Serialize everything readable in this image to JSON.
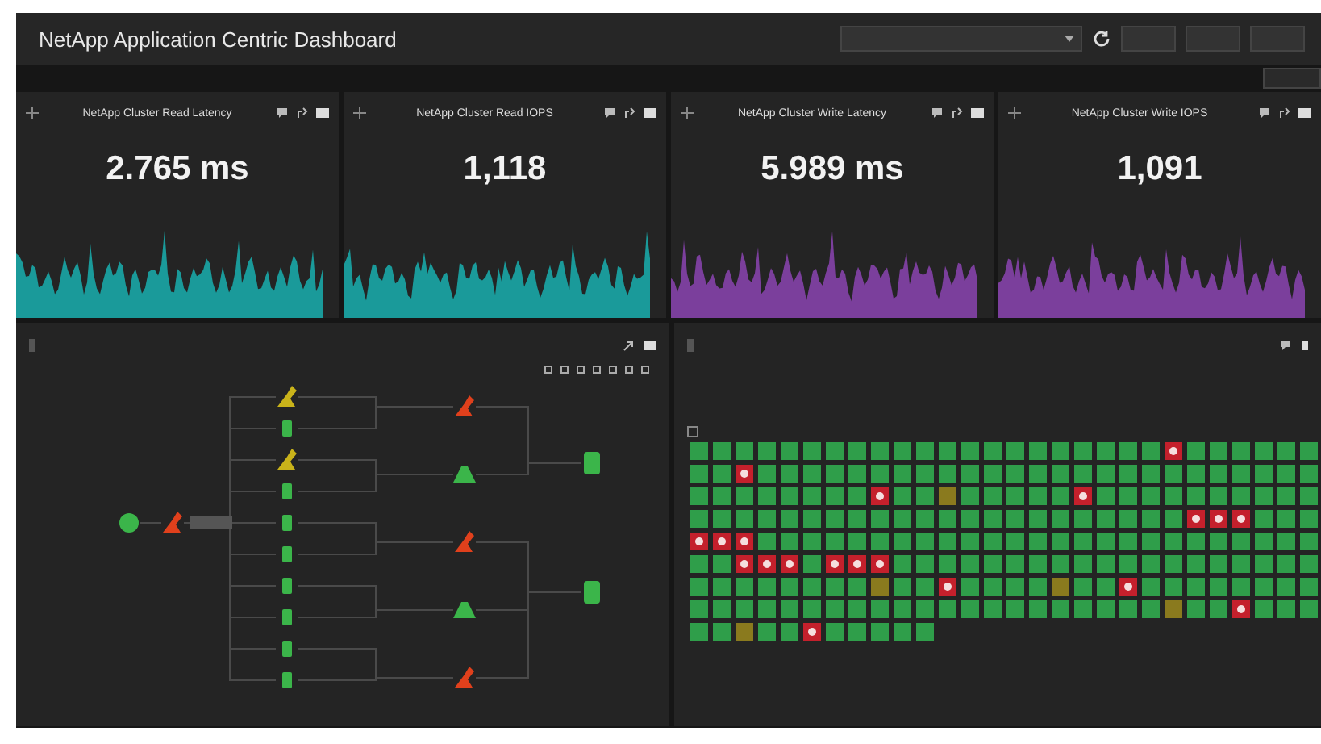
{
  "header": {
    "title": "NetApp Application Centric Dashboard"
  },
  "stat_panels": [
    {
      "title": "NetApp Cluster Read Latency",
      "value": "2.765 ms",
      "color": "#1a9a9a"
    },
    {
      "title": "NetApp Cluster Read IOPS",
      "value": "1,118",
      "color": "#1a9a9a"
    },
    {
      "title": "NetApp Cluster Write Latency",
      "value": "5.989 ms",
      "color": "#7b3f9c"
    },
    {
      "title": "NetApp Cluster Write IOPS",
      "value": "1,091",
      "color": "#7b3f9c"
    }
  ],
  "topology": {
    "columns": [
      [
        {
          "kind": "endpoint",
          "color": "#3bb54a"
        }
      ],
      [
        {
          "kind": "service",
          "color": "#e0401c"
        }
      ],
      [
        {
          "kind": "service",
          "color": "#c9b31a"
        },
        {
          "kind": "vm",
          "color": "#3bb54a"
        },
        {
          "kind": "service",
          "color": "#c9b31a"
        },
        {
          "kind": "vm",
          "color": "#3bb54a"
        },
        {
          "kind": "vm",
          "color": "#3bb54a"
        },
        {
          "kind": "vm",
          "color": "#3bb54a"
        },
        {
          "kind": "vm",
          "color": "#3bb54a"
        },
        {
          "kind": "vm",
          "color": "#3bb54a"
        },
        {
          "kind": "vm",
          "color": "#3bb54a"
        },
        {
          "kind": "vm",
          "color": "#3bb54a"
        }
      ],
      [
        {
          "kind": "service",
          "color": "#e0401c"
        },
        {
          "kind": "host",
          "color": "#3bb54a"
        },
        {
          "kind": "service",
          "color": "#e0401c"
        },
        {
          "kind": "host",
          "color": "#3bb54a"
        },
        {
          "kind": "service",
          "color": "#e0401c"
        }
      ],
      [
        {
          "kind": "storage",
          "color": "#3bb54a"
        },
        {
          "kind": "storage",
          "color": "#3bb54a"
        }
      ]
    ]
  },
  "heatmap": {
    "legend": {
      "checked": false
    },
    "rows": [
      [
        {
          "color": "#2f9e4a"
        },
        {
          "color": "#2f9e4a"
        },
        {
          "color": "#2f9e4a"
        },
        {
          "color": "#2f9e4a"
        },
        {
          "color": "#2f9e4a"
        },
        {
          "color": "#2f9e4a"
        },
        {
          "color": "#2f9e4a"
        },
        {
          "color": "#2f9e4a"
        },
        {
          "color": "#2f9e4a"
        },
        {
          "color": "#2f9e4a"
        },
        {
          "color": "#2f9e4a"
        },
        {
          "color": "#2f9e4a"
        },
        {
          "color": "#2f9e4a"
        },
        {
          "color": "#2f9e4a"
        },
        {
          "color": "#2f9e4a"
        },
        {
          "color": "#2f9e4a"
        },
        {
          "color": "#2f9e4a"
        },
        {
          "color": "#2f9e4a"
        },
        {
          "color": "#2f9e4a"
        },
        {
          "color": "#2f9e4a"
        },
        {
          "color": "#2f9e4a"
        },
        {
          "color": "#c4202c"
        },
        {
          "color": "#2f9e4a"
        },
        {
          "color": "#2f9e4a"
        },
        {
          "color": "#2f9e4a"
        },
        {
          "color": "#2f9e4a"
        },
        {
          "color": "#2f9e4a"
        },
        {
          "color": "#2f9e4a"
        }
      ],
      [
        {
          "color": "#2f9e4a"
        },
        {
          "color": "#2f9e4a"
        },
        {
          "color": "#c4202c"
        },
        {
          "color": "#2f9e4a"
        },
        {
          "color": "#2f9e4a"
        },
        {
          "color": "#2f9e4a"
        },
        {
          "color": "#2f9e4a"
        },
        {
          "color": "#2f9e4a"
        },
        {
          "color": "#2f9e4a"
        },
        {
          "color": "#2f9e4a"
        },
        {
          "color": "#2f9e4a"
        },
        {
          "color": "#2f9e4a"
        },
        {
          "color": "#2f9e4a"
        },
        {
          "color": "#2f9e4a"
        },
        {
          "color": "#2f9e4a"
        },
        {
          "color": "#2f9e4a"
        },
        {
          "color": "#2f9e4a"
        },
        {
          "color": "#2f9e4a"
        },
        {
          "color": "#2f9e4a"
        },
        {
          "color": "#2f9e4a"
        },
        {
          "color": "#2f9e4a"
        },
        {
          "color": "#2f9e4a"
        },
        {
          "color": "#2f9e4a"
        },
        {
          "color": "#2f9e4a"
        },
        {
          "color": "#2f9e4a"
        },
        {
          "color": "#2f9e4a"
        },
        {
          "color": "#2f9e4a"
        },
        {
          "color": "#2f9e4a"
        }
      ],
      [
        {
          "color": "#2f9e4a"
        },
        {
          "color": "#2f9e4a"
        },
        {
          "color": "#2f9e4a"
        },
        {
          "color": "#2f9e4a"
        },
        {
          "color": "#2f9e4a"
        },
        {
          "color": "#2f9e4a"
        },
        {
          "color": "#2f9e4a"
        },
        {
          "color": "#2f9e4a"
        },
        {
          "color": "#c4202c"
        },
        {
          "color": "#2f9e4a"
        },
        {
          "color": "#2f9e4a"
        },
        {
          "color": "#8a7a1e"
        },
        {
          "color": "#2f9e4a"
        },
        {
          "color": "#2f9e4a"
        },
        {
          "color": "#2f9e4a"
        },
        {
          "color": "#2f9e4a"
        },
        {
          "color": "#2f9e4a"
        },
        {
          "color": "#c4202c"
        },
        {
          "color": "#2f9e4a"
        },
        {
          "color": "#2f9e4a"
        },
        {
          "color": "#2f9e4a"
        },
        {
          "color": "#2f9e4a"
        },
        {
          "color": "#2f9e4a"
        },
        {
          "color": "#2f9e4a"
        },
        {
          "color": "#2f9e4a"
        },
        {
          "color": "#2f9e4a"
        },
        {
          "color": "#2f9e4a"
        },
        {
          "color": "#2f9e4a"
        }
      ],
      [
        {
          "color": "#2f9e4a"
        },
        {
          "color": "#2f9e4a"
        },
        {
          "color": "#2f9e4a"
        },
        {
          "color": "#2f9e4a"
        },
        {
          "color": "#2f9e4a"
        },
        {
          "color": "#2f9e4a"
        },
        {
          "color": "#2f9e4a"
        },
        {
          "color": "#2f9e4a"
        },
        {
          "color": "#2f9e4a"
        },
        {
          "color": "#2f9e4a"
        },
        {
          "color": "#2f9e4a"
        },
        {
          "color": "#2f9e4a"
        },
        {
          "color": "#2f9e4a"
        },
        {
          "color": "#2f9e4a"
        },
        {
          "color": "#2f9e4a"
        },
        {
          "color": "#2f9e4a"
        },
        {
          "color": "#2f9e4a"
        },
        {
          "color": "#2f9e4a"
        },
        {
          "color": "#2f9e4a"
        },
        {
          "color": "#2f9e4a"
        },
        {
          "color": "#2f9e4a"
        },
        {
          "color": "#2f9e4a"
        },
        {
          "color": "#c4202c"
        },
        {
          "color": "#c4202c"
        },
        {
          "color": "#c4202c"
        },
        {
          "color": "#2f9e4a"
        },
        {
          "color": "#2f9e4a"
        },
        {
          "color": "#2f9e4a"
        }
      ],
      [
        {
          "color": "#c4202c"
        },
        {
          "color": "#c4202c"
        },
        {
          "color": "#c4202c"
        },
        {
          "color": "#2f9e4a"
        },
        {
          "color": "#2f9e4a"
        },
        {
          "color": "#2f9e4a"
        },
        {
          "color": "#2f9e4a"
        },
        {
          "color": "#2f9e4a"
        },
        {
          "color": "#2f9e4a"
        },
        {
          "color": "#2f9e4a"
        },
        {
          "color": "#2f9e4a"
        },
        {
          "color": "#2f9e4a"
        },
        {
          "color": "#2f9e4a"
        },
        {
          "color": "#2f9e4a"
        },
        {
          "color": "#2f9e4a"
        },
        {
          "color": "#2f9e4a"
        },
        {
          "color": "#2f9e4a"
        },
        {
          "color": "#2f9e4a"
        },
        {
          "color": "#2f9e4a"
        },
        {
          "color": "#2f9e4a"
        },
        {
          "color": "#2f9e4a"
        },
        {
          "color": "#2f9e4a"
        },
        {
          "color": "#2f9e4a"
        },
        {
          "color": "#2f9e4a"
        },
        {
          "color": "#2f9e4a"
        },
        {
          "color": "#2f9e4a"
        },
        {
          "color": "#2f9e4a"
        },
        {
          "color": "#2f9e4a"
        }
      ],
      [
        {
          "color": "#2f9e4a"
        },
        {
          "color": "#2f9e4a"
        },
        {
          "color": "#c4202c"
        },
        {
          "color": "#c4202c"
        },
        {
          "color": "#c4202c"
        },
        {
          "color": "#2f9e4a"
        },
        {
          "color": "#c4202c"
        },
        {
          "color": "#c4202c"
        },
        {
          "color": "#c4202c"
        },
        {
          "color": "#2f9e4a"
        },
        {
          "color": "#2f9e4a"
        },
        {
          "color": "#2f9e4a"
        },
        {
          "color": "#2f9e4a"
        },
        {
          "color": "#2f9e4a"
        },
        {
          "color": "#2f9e4a"
        },
        {
          "color": "#2f9e4a"
        },
        {
          "color": "#2f9e4a"
        },
        {
          "color": "#2f9e4a"
        },
        {
          "color": "#2f9e4a"
        },
        {
          "color": "#2f9e4a"
        },
        {
          "color": "#2f9e4a"
        },
        {
          "color": "#2f9e4a"
        },
        {
          "color": "#2f9e4a"
        },
        {
          "color": "#2f9e4a"
        },
        {
          "color": "#2f9e4a"
        },
        {
          "color": "#2f9e4a"
        },
        {
          "color": "#2f9e4a"
        },
        {
          "color": "#2f9e4a"
        }
      ],
      [
        {
          "color": "#2f9e4a"
        },
        {
          "color": "#2f9e4a"
        },
        {
          "color": "#2f9e4a"
        },
        {
          "color": "#2f9e4a"
        },
        {
          "color": "#2f9e4a"
        },
        {
          "color": "#2f9e4a"
        },
        {
          "color": "#2f9e4a"
        },
        {
          "color": "#2f9e4a"
        },
        {
          "color": "#8a7a1e"
        },
        {
          "color": "#2f9e4a"
        },
        {
          "color": "#2f9e4a"
        },
        {
          "color": "#c4202c"
        },
        {
          "color": "#2f9e4a"
        },
        {
          "color": "#2f9e4a"
        },
        {
          "color": "#2f9e4a"
        },
        {
          "color": "#2f9e4a"
        },
        {
          "color": "#8a7a1e"
        },
        {
          "color": "#2f9e4a"
        },
        {
          "color": "#2f9e4a"
        },
        {
          "color": "#c4202c"
        },
        {
          "color": "#2f9e4a"
        },
        {
          "color": "#2f9e4a"
        },
        {
          "color": "#2f9e4a"
        },
        {
          "color": "#2f9e4a"
        },
        {
          "color": "#2f9e4a"
        },
        {
          "color": "#2f9e4a"
        },
        {
          "color": "#2f9e4a"
        },
        {
          "color": "#2f9e4a"
        }
      ],
      [
        {
          "color": "#2f9e4a"
        },
        {
          "color": "#2f9e4a"
        },
        {
          "color": "#2f9e4a"
        },
        {
          "color": "#2f9e4a"
        },
        {
          "color": "#2f9e4a"
        },
        {
          "color": "#2f9e4a"
        },
        {
          "color": "#2f9e4a"
        },
        {
          "color": "#2f9e4a"
        },
        {
          "color": "#2f9e4a"
        },
        {
          "color": "#2f9e4a"
        },
        {
          "color": "#2f9e4a"
        },
        {
          "color": "#2f9e4a"
        },
        {
          "color": "#2f9e4a"
        },
        {
          "color": "#2f9e4a"
        },
        {
          "color": "#2f9e4a"
        },
        {
          "color": "#2f9e4a"
        },
        {
          "color": "#2f9e4a"
        },
        {
          "color": "#2f9e4a"
        },
        {
          "color": "#2f9e4a"
        },
        {
          "color": "#2f9e4a"
        },
        {
          "color": "#2f9e4a"
        },
        {
          "color": "#8a7a1e"
        },
        {
          "color": "#2f9e4a"
        },
        {
          "color": "#2f9e4a"
        },
        {
          "color": "#c4202c"
        },
        {
          "color": "#2f9e4a"
        },
        {
          "color": "#2f9e4a"
        },
        {
          "color": "#2f9e4a"
        }
      ],
      [
        {
          "color": "#2f9e4a"
        },
        {
          "color": "#2f9e4a"
        },
        {
          "color": "#8a7a1e"
        },
        {
          "color": "#2f9e4a"
        },
        {
          "color": "#2f9e4a"
        },
        {
          "color": "#c4202c"
        },
        {
          "color": "#2f9e4a"
        },
        {
          "color": "#2f9e4a"
        },
        {
          "color": "#2f9e4a"
        },
        {
          "color": "#2f9e4a"
        },
        {
          "color": "#2f9e4a"
        }
      ]
    ]
  }
}
